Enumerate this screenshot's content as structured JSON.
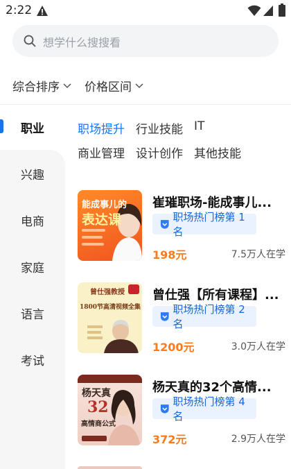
{
  "status": {
    "time": "2:22"
  },
  "search": {
    "placeholder": "想学什么搜搜看"
  },
  "filters": {
    "sort": "综合排序",
    "price": "价格区间"
  },
  "categories": [
    "职业",
    "兴趣",
    "电商",
    "家庭",
    "语言",
    "考试"
  ],
  "subtags": [
    "职场提升",
    "行业技能",
    "IT",
    "商业管理",
    "设计创作",
    "其他技能"
  ],
  "courses": [
    {
      "title": "崔璀职场-能成事儿...",
      "rank": "职场热门榜第 1 名",
      "price": "198元",
      "learners": "7.5万人在学",
      "thumb_lines": [
        "能成事儿的",
        "表达课"
      ]
    },
    {
      "title": "曾仕强【所有课程】...",
      "rank": "职场热门榜第 2 名",
      "price": "1200元",
      "learners": "3.0万人在学",
      "thumb_lines": [
        "曾仕强教授",
        "1800节高清视频全集"
      ]
    },
    {
      "title": "杨天真的32个高情...",
      "rank": "职场热门榜第 4 名",
      "price": "372元",
      "learners": "2.9万人在学",
      "thumb_lines": [
        "杨天真",
        "32",
        "高情商公式"
      ]
    }
  ],
  "colors": {
    "accent": "#1677ff",
    "price": "#ff7a1a",
    "rank_bg": "#eaf2ff"
  }
}
